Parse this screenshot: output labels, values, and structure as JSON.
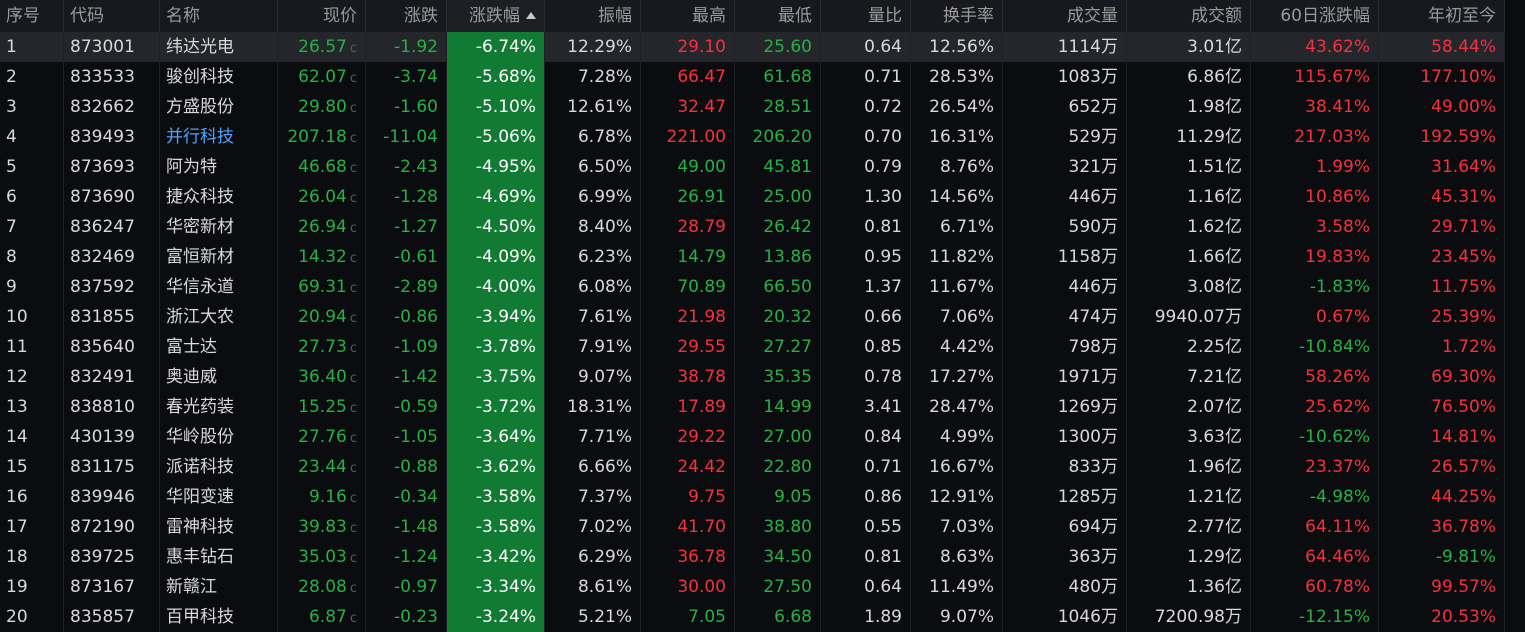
{
  "headers": {
    "seq": "序号",
    "code": "代码",
    "name": "名称",
    "price": "现价",
    "change": "涨跌",
    "pct": "涨跌幅",
    "amplitude": "振幅",
    "high": "最高",
    "low": "最低",
    "vol_ratio": "量比",
    "turnover": "换手率",
    "volume": "成交量",
    "amount": "成交额",
    "chg60": "60日涨跌幅",
    "ytd": "年初至今"
  },
  "price_suffix": "c",
  "colors": {
    "up": "#f2333d",
    "down": "#27b043",
    "pct_bg": "#117a33",
    "link": "#4da3ff"
  },
  "rows": [
    {
      "seq": "1",
      "code": "873001",
      "name": "纬达光电",
      "price": "26.57",
      "change": "-1.92",
      "pct": "-6.74%",
      "amplitude": "12.29%",
      "high": "29.10",
      "low": "25.60",
      "vol_ratio": "0.64",
      "turnover": "12.56%",
      "volume": "1114万",
      "amount": "3.01亿",
      "chg60": "43.62%",
      "ytd": "58.44%"
    },
    {
      "seq": "2",
      "code": "833533",
      "name": "骏创科技",
      "price": "62.07",
      "change": "-3.74",
      "pct": "-5.68%",
      "amplitude": "7.28%",
      "high": "66.47",
      "low": "61.68",
      "vol_ratio": "0.71",
      "turnover": "28.53%",
      "volume": "1083万",
      "amount": "6.86亿",
      "chg60": "115.67%",
      "ytd": "177.10%"
    },
    {
      "seq": "3",
      "code": "832662",
      "name": "方盛股份",
      "price": "29.80",
      "change": "-1.60",
      "pct": "-5.10%",
      "amplitude": "12.61%",
      "high": "32.47",
      "low": "28.51",
      "vol_ratio": "0.72",
      "turnover": "26.54%",
      "volume": "652万",
      "amount": "1.98亿",
      "chg60": "38.41%",
      "ytd": "49.00%"
    },
    {
      "seq": "4",
      "code": "839493",
      "name": "并行科技",
      "price": "207.18",
      "change": "-11.04",
      "pct": "-5.06%",
      "amplitude": "6.78%",
      "high": "221.00",
      "low": "206.20",
      "vol_ratio": "0.70",
      "turnover": "16.31%",
      "volume": "529万",
      "amount": "11.29亿",
      "chg60": "217.03%",
      "ytd": "192.59%"
    },
    {
      "seq": "5",
      "code": "873693",
      "name": "阿为特",
      "price": "46.68",
      "change": "-2.43",
      "pct": "-4.95%",
      "amplitude": "6.50%",
      "high": "49.00",
      "low": "45.81",
      "vol_ratio": "0.79",
      "turnover": "8.76%",
      "volume": "321万",
      "amount": "1.51亿",
      "chg60": "1.99%",
      "ytd": "31.64%"
    },
    {
      "seq": "6",
      "code": "873690",
      "name": "捷众科技",
      "price": "26.04",
      "change": "-1.28",
      "pct": "-4.69%",
      "amplitude": "6.99%",
      "high": "26.91",
      "low": "25.00",
      "vol_ratio": "1.30",
      "turnover": "14.56%",
      "volume": "446万",
      "amount": "1.16亿",
      "chg60": "10.86%",
      "ytd": "45.31%"
    },
    {
      "seq": "7",
      "code": "836247",
      "name": "华密新材",
      "price": "26.94",
      "change": "-1.27",
      "pct": "-4.50%",
      "amplitude": "8.40%",
      "high": "28.79",
      "low": "26.42",
      "vol_ratio": "0.81",
      "turnover": "6.71%",
      "volume": "590万",
      "amount": "1.62亿",
      "chg60": "3.58%",
      "ytd": "29.71%"
    },
    {
      "seq": "8",
      "code": "832469",
      "name": "富恒新材",
      "price": "14.32",
      "change": "-0.61",
      "pct": "-4.09%",
      "amplitude": "6.23%",
      "high": "14.79",
      "low": "13.86",
      "vol_ratio": "0.95",
      "turnover": "11.82%",
      "volume": "1158万",
      "amount": "1.66亿",
      "chg60": "19.83%",
      "ytd": "23.45%"
    },
    {
      "seq": "9",
      "code": "837592",
      "name": "华信永道",
      "price": "69.31",
      "change": "-2.89",
      "pct": "-4.00%",
      "amplitude": "6.08%",
      "high": "70.89",
      "low": "66.50",
      "vol_ratio": "1.37",
      "turnover": "11.67%",
      "volume": "446万",
      "amount": "3.08亿",
      "chg60": "-1.83%",
      "ytd": "11.75%"
    },
    {
      "seq": "10",
      "code": "831855",
      "name": "浙江大农",
      "price": "20.94",
      "change": "-0.86",
      "pct": "-3.94%",
      "amplitude": "7.61%",
      "high": "21.98",
      "low": "20.32",
      "vol_ratio": "0.66",
      "turnover": "7.06%",
      "volume": "474万",
      "amount": "9940.07万",
      "chg60": "0.67%",
      "ytd": "25.39%"
    },
    {
      "seq": "11",
      "code": "835640",
      "name": "富士达",
      "price": "27.73",
      "change": "-1.09",
      "pct": "-3.78%",
      "amplitude": "7.91%",
      "high": "29.55",
      "low": "27.27",
      "vol_ratio": "0.85",
      "turnover": "4.42%",
      "volume": "798万",
      "amount": "2.25亿",
      "chg60": "-10.84%",
      "ytd": "1.72%"
    },
    {
      "seq": "12",
      "code": "832491",
      "name": "奥迪威",
      "price": "36.40",
      "change": "-1.42",
      "pct": "-3.75%",
      "amplitude": "9.07%",
      "high": "38.78",
      "low": "35.35",
      "vol_ratio": "0.78",
      "turnover": "17.27%",
      "volume": "1971万",
      "amount": "7.21亿",
      "chg60": "58.26%",
      "ytd": "69.30%"
    },
    {
      "seq": "13",
      "code": "838810",
      "name": "春光药装",
      "price": "15.25",
      "change": "-0.59",
      "pct": "-3.72%",
      "amplitude": "18.31%",
      "high": "17.89",
      "low": "14.99",
      "vol_ratio": "3.41",
      "turnover": "28.47%",
      "volume": "1269万",
      "amount": "2.07亿",
      "chg60": "25.62%",
      "ytd": "76.50%"
    },
    {
      "seq": "14",
      "code": "430139",
      "name": "华岭股份",
      "price": "27.76",
      "change": "-1.05",
      "pct": "-3.64%",
      "amplitude": "7.71%",
      "high": "29.22",
      "low": "27.00",
      "vol_ratio": "0.84",
      "turnover": "4.99%",
      "volume": "1300万",
      "amount": "3.63亿",
      "chg60": "-10.62%",
      "ytd": "14.81%"
    },
    {
      "seq": "15",
      "code": "831175",
      "name": "派诺科技",
      "price": "23.44",
      "change": "-0.88",
      "pct": "-3.62%",
      "amplitude": "6.66%",
      "high": "24.42",
      "low": "22.80",
      "vol_ratio": "0.71",
      "turnover": "16.67%",
      "volume": "833万",
      "amount": "1.96亿",
      "chg60": "23.37%",
      "ytd": "26.57%"
    },
    {
      "seq": "16",
      "code": "839946",
      "name": "华阳变速",
      "price": "9.16",
      "change": "-0.34",
      "pct": "-3.58%",
      "amplitude": "7.37%",
      "high": "9.75",
      "low": "9.05",
      "vol_ratio": "0.86",
      "turnover": "12.91%",
      "volume": "1285万",
      "amount": "1.21亿",
      "chg60": "-4.98%",
      "ytd": "44.25%"
    },
    {
      "seq": "17",
      "code": "872190",
      "name": "雷神科技",
      "price": "39.83",
      "change": "-1.48",
      "pct": "-3.58%",
      "amplitude": "7.02%",
      "high": "41.70",
      "low": "38.80",
      "vol_ratio": "0.55",
      "turnover": "7.03%",
      "volume": "694万",
      "amount": "2.77亿",
      "chg60": "64.11%",
      "ytd": "36.78%"
    },
    {
      "seq": "18",
      "code": "839725",
      "name": "惠丰钻石",
      "price": "35.03",
      "change": "-1.24",
      "pct": "-3.42%",
      "amplitude": "6.29%",
      "high": "36.78",
      "low": "34.50",
      "vol_ratio": "0.81",
      "turnover": "8.63%",
      "volume": "363万",
      "amount": "1.29亿",
      "chg60": "64.46%",
      "ytd": "-9.81%"
    },
    {
      "seq": "19",
      "code": "873167",
      "name": "新赣江",
      "price": "28.08",
      "change": "-0.97",
      "pct": "-3.34%",
      "amplitude": "8.61%",
      "high": "30.00",
      "low": "27.50",
      "vol_ratio": "0.64",
      "turnover": "11.49%",
      "volume": "480万",
      "amount": "1.36亿",
      "chg60": "60.78%",
      "ytd": "99.57%"
    },
    {
      "seq": "20",
      "code": "835857",
      "name": "百甲科技",
      "price": "6.87",
      "change": "-0.23",
      "pct": "-3.24%",
      "amplitude": "5.21%",
      "high": "7.05",
      "low": "6.68",
      "vol_ratio": "1.89",
      "turnover": "9.07%",
      "volume": "1046万",
      "amount": "7200.98万",
      "chg60": "-12.15%",
      "ytd": "20.53%"
    }
  ]
}
